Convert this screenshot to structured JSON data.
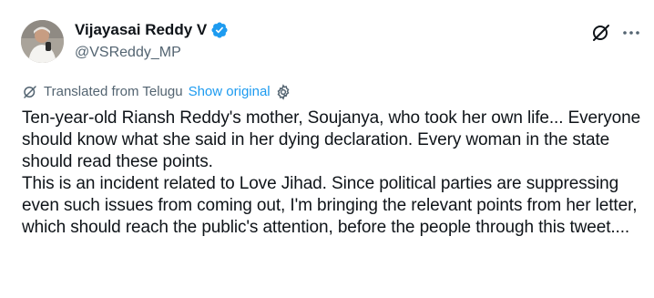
{
  "author": {
    "display_name": "Vijayasai Reddy V",
    "handle": "@VSReddy_MP",
    "verified_icon": "verified-badge-icon",
    "verified_color": "#1d9bf0"
  },
  "actions": {
    "grok_icon": "grok-icon",
    "more_icon": "more-options-icon"
  },
  "translation": {
    "label": "Translated from Telugu",
    "show_original": "Show original",
    "icon": "translate-icon",
    "settings_icon": "gear-icon",
    "link_color": "#1d9bf0"
  },
  "tweet": {
    "paragraphs": [
      "Ten-year-old Riansh Reddy's mother, Soujanya, who took her own life... Everyone should know what she said in her dying declaration. Every woman in the state should read these points.",
      "This is an incident related to Love Jihad. Since political parties are suppressing even such issues from coming out, I'm bringing the relevant points from her letter, which should reach the public's attention, before the people through this tweet...."
    ]
  }
}
